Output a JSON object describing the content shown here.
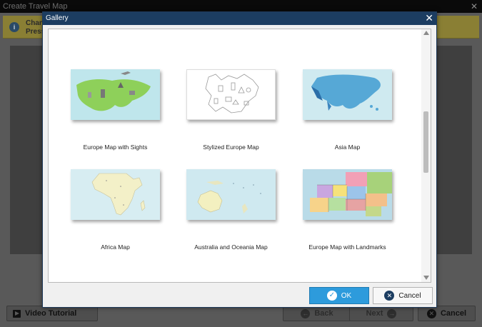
{
  "parent": {
    "title": "Create Travel Map",
    "info_line1": "Chang",
    "info_line2": "Press a",
    "video_tutorial": "Video Tutorial",
    "back": "Back",
    "next": "Next",
    "cancel": "Cancel"
  },
  "dialog": {
    "title": "Gallery",
    "ok": "OK",
    "cancel": "Cancel",
    "items": [
      {
        "label": "Europe Map with Sights"
      },
      {
        "label": "Stylized Europe Map"
      },
      {
        "label": "Asia Map"
      },
      {
        "label": "Africa Map"
      },
      {
        "label": "Australia and Oceania Map"
      },
      {
        "label": "Europe Map with Landmarks"
      }
    ]
  },
  "colors": {
    "dialog_titlebar": "#1c3d61",
    "ok_button": "#2d9bdc",
    "info_bar": "#8a7f34"
  }
}
